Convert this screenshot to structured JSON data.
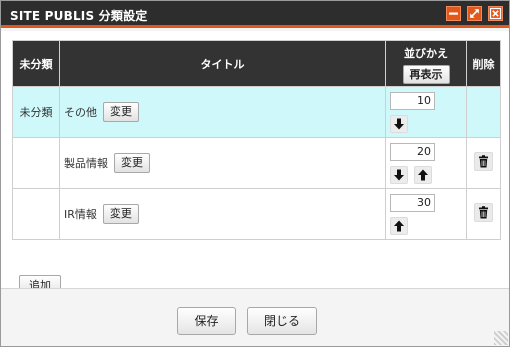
{
  "window": {
    "title": "SITE PUBLIS 分類設定",
    "accent_color": "#e2571a",
    "titlebar_color": "#2d2d2d",
    "controls": [
      "minimize-icon",
      "maximize-icon",
      "close-icon"
    ]
  },
  "table": {
    "headers": {
      "uncategorized": "未分類",
      "title": "タイトル",
      "sort": "並びかえ",
      "redisplay_button": "再表示",
      "delete": "削除"
    },
    "rows": [
      {
        "uncategorized_label": "未分類",
        "title": "その他",
        "change_label": "変更",
        "order": "10",
        "arrows": [
          "down"
        ],
        "deletable": false
      },
      {
        "uncategorized_label": "",
        "title": "製品情報",
        "change_label": "変更",
        "order": "20",
        "arrows": [
          "down",
          "up"
        ],
        "deletable": true
      },
      {
        "uncategorized_label": "",
        "title": "IR情報",
        "change_label": "変更",
        "order": "30",
        "arrows": [
          "up"
        ],
        "deletable": true
      }
    ],
    "highlight_color": "#cff8fb"
  },
  "add_button": "追加",
  "footer": {
    "save_label": "保存",
    "close_label": "閉じる"
  }
}
